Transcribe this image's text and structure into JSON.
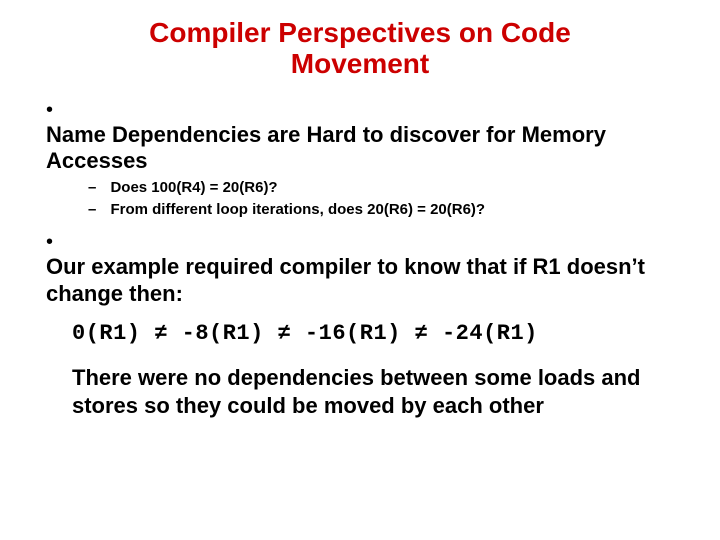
{
  "title": "Compiler Perspectives on Code Movement",
  "bullets": [
    {
      "text": "Name Dependencies are Hard to discover for Memory Accesses",
      "sub": [
        "Does 100(R4) = 20(R6)?",
        "From different loop iterations, does 20(R6) = 20(R6)?"
      ]
    },
    {
      "text": "Our example required compiler to know that if R1 doesn’t change then:"
    }
  ],
  "mono_line": "0(R1) ≠ -8(R1) ≠ -16(R1) ≠ -24(R1)",
  "final_para": "There were no dependencies between some loads and stores so they could be moved by each other",
  "glyphs": {
    "bullet": "•",
    "dash": "–"
  }
}
